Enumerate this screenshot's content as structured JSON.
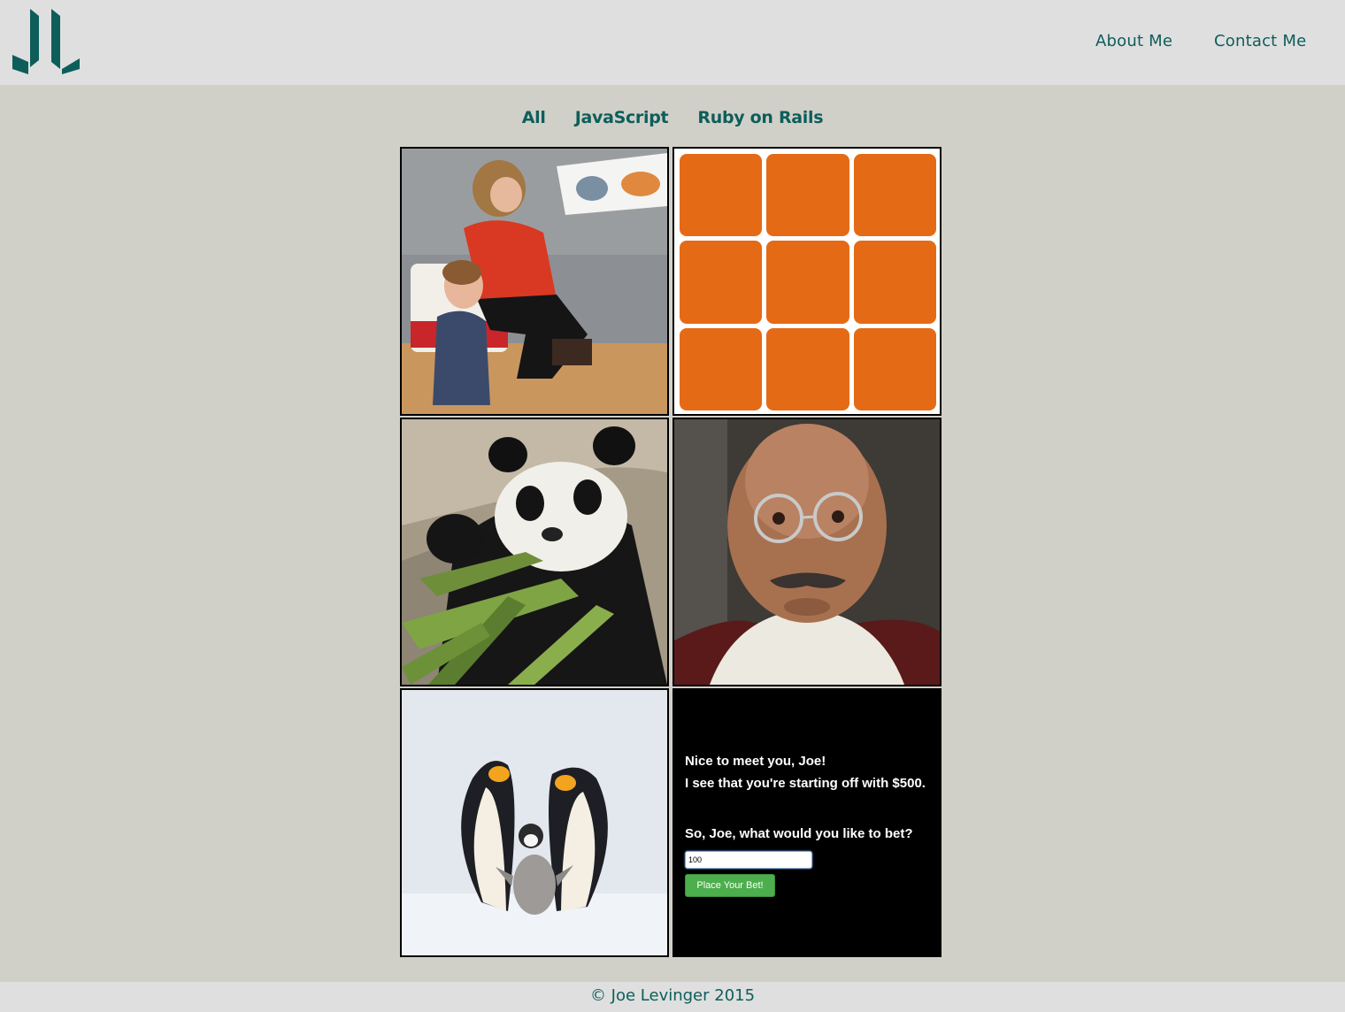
{
  "header": {
    "logo": "JL monogram logo",
    "nav": [
      {
        "label": "About Me"
      },
      {
        "label": "Contact Me"
      }
    ]
  },
  "filters": [
    "All",
    "JavaScript",
    "Ruby on Rails"
  ],
  "portfolio": {
    "tiles": [
      {
        "image": "woman reading picture book to child photo"
      },
      {
        "image": "orange 3x3 card grid game"
      },
      {
        "image": "panda eating bamboo photo"
      },
      {
        "image": "bald man with round glasses portrait photo"
      },
      {
        "image": "emperor penguin family photo"
      },
      {
        "image": "betting game screen"
      }
    ],
    "bet_game": {
      "greeting": "Nice to meet you, Joe!",
      "bankroll": "I see that you're starting off with $500.",
      "prompt": "So, Joe, what would you like to bet?",
      "input_value": "100",
      "button_label": "Place Your Bet!"
    }
  },
  "footer": {
    "text": "© Joe Levinger 2015"
  },
  "colors": {
    "accent": "#0d5e5b",
    "background": "#d1d0c8",
    "header": "#dfdfdf",
    "card": "#e56a16",
    "bet_button": "#4cae4c"
  }
}
